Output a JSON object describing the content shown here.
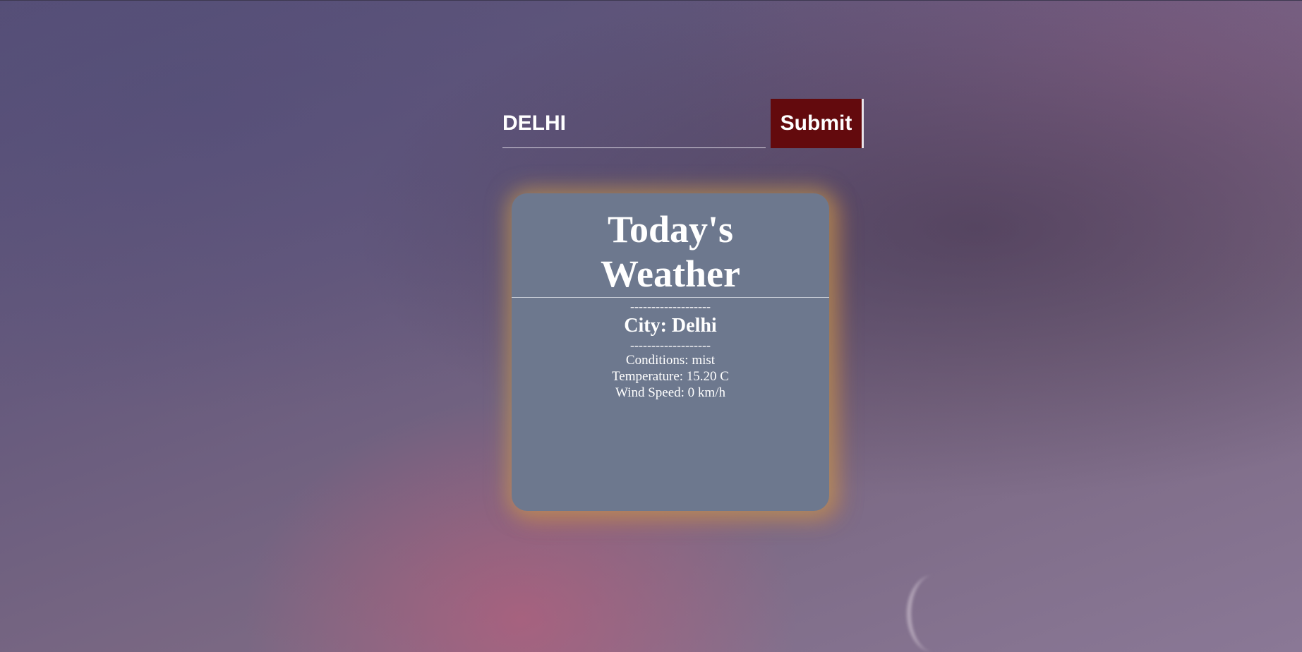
{
  "search": {
    "value": "DELHI",
    "submit_label": "Submit"
  },
  "card": {
    "title_line1": "Today's",
    "title_line2": "Weather",
    "divider": "-------------------",
    "city": "City: Delhi",
    "conditions": "Conditions: mist",
    "temperature": "Temperature: 15.20 C",
    "wind": "Wind Speed: 0 km/h"
  },
  "colors": {
    "submit_bg": "#630a0d",
    "card_bg": "#6d788e",
    "card_glow": "#c8a050"
  }
}
